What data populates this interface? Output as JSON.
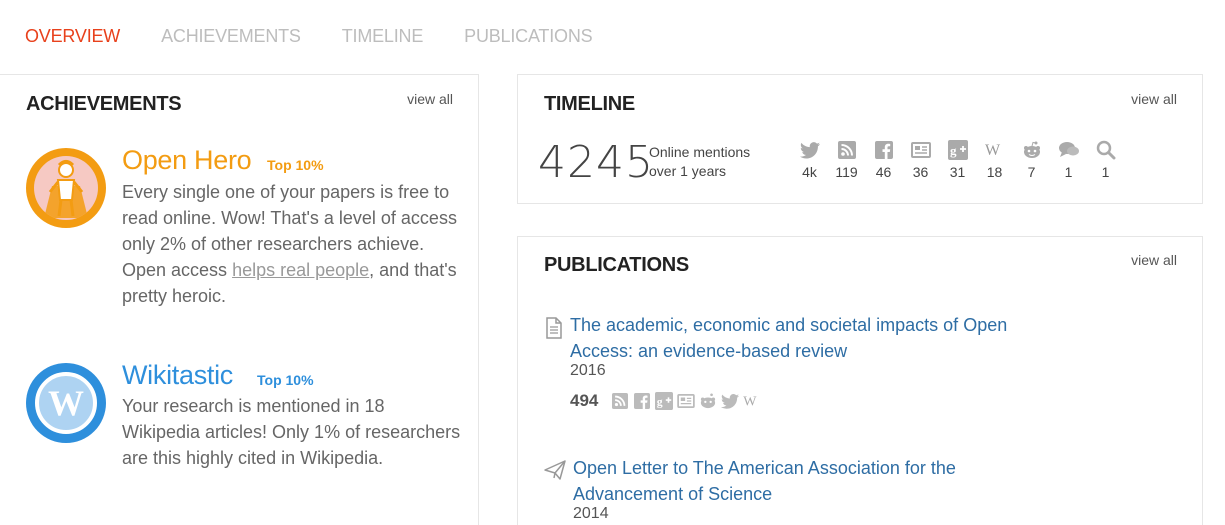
{
  "tabs": [
    {
      "label": "OVERVIEW",
      "active": true
    },
    {
      "label": "ACHIEVEMENTS",
      "active": false
    },
    {
      "label": "TIMELINE",
      "active": false
    },
    {
      "label": "PUBLICATIONS",
      "active": false
    }
  ],
  "achievements": {
    "title": "ACHIEVEMENTS",
    "view_all": "view all",
    "items": [
      {
        "name": "Open Hero",
        "tag": "Top 10%",
        "desc_before": "Every single one of your papers is free to read online. Wow! That's a level of access only 2% of other researchers achieve. Open access ",
        "link": "helps real people",
        "desc_after": ", and that's pretty heroic.",
        "icon": "open-hero-icon",
        "color": "#f39c12"
      },
      {
        "name": "Wikitastic",
        "tag": "Top 10%",
        "desc": "Your research is mentioned in 18 Wikipedia articles! Only 1% of researchers are this highly cited in Wikipedia.",
        "icon": "wikipedia-icon",
        "icon_letter": "W",
        "color": "#2e8fdc"
      }
    ]
  },
  "timeline": {
    "title": "TIMELINE",
    "view_all": "view all",
    "total": "4245",
    "mentions_line1": "Online mentions",
    "mentions_line2": "over 1 years",
    "sources": [
      {
        "icon": "twitter-icon",
        "count": "4k"
      },
      {
        "icon": "rss-icon",
        "count": "119"
      },
      {
        "icon": "facebook-icon",
        "count": "46"
      },
      {
        "icon": "news-icon",
        "count": "36"
      },
      {
        "icon": "google-plus-icon",
        "count": "31"
      },
      {
        "icon": "wikipedia-icon",
        "count": "18"
      },
      {
        "icon": "reddit-icon",
        "count": "7"
      },
      {
        "icon": "comments-icon",
        "count": "1"
      },
      {
        "icon": "search-icon",
        "count": "1"
      }
    ]
  },
  "publications": {
    "title": "PUBLICATIONS",
    "view_all": "view all",
    "items": [
      {
        "title": "The academic, economic and societal impacts of Open Access: an evidence-based review",
        "year": "2016",
        "score": "494",
        "icon": "document-icon"
      },
      {
        "title": "Open Letter to The American Association for the Advancement of Science",
        "year": "2014",
        "icon": "paper-plane-icon"
      }
    ]
  },
  "colors": {
    "accent": "#e8411c",
    "link": "#2e6da4",
    "orange": "#f39c12",
    "blue": "#2e8fdc",
    "icon_gray": "#aaaaaa"
  }
}
